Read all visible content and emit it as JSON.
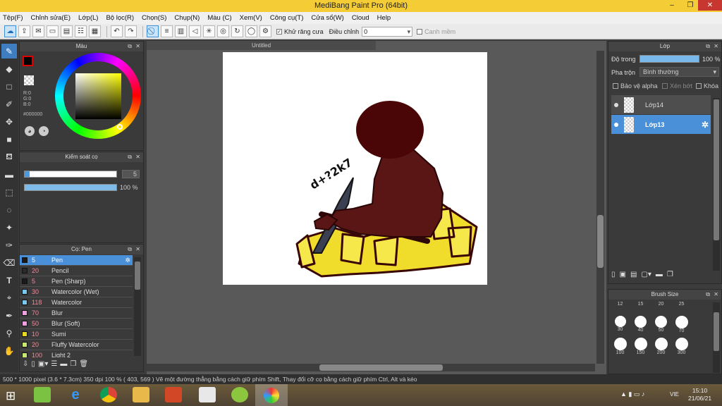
{
  "app": {
    "title": "MediBang Paint Pro (64bit)"
  },
  "menu": [
    "Tệp(F)",
    "Chỉnh sửa(E)",
    "Lớp(L)",
    "Bộ lọc(R)",
    "Chọn(S)",
    "Chụp(N)",
    "Màu (C)",
    "Xem(V)",
    "Công cụ(T)",
    "Cửa sổ(W)",
    "Cloud",
    "Help"
  ],
  "toolbar": {
    "antialias_label": "Khử răng cưa",
    "adjust_label": "Điều chỉnh",
    "adjust_value": "0",
    "smooth_label": "Canh mềm"
  },
  "color_panel": {
    "title": "Màu",
    "r": "R:0",
    "g": "G:0",
    "b": "B:0",
    "hex": "#000000"
  },
  "brush_control": {
    "title": "Kiểm soát cọ",
    "size_value": "5",
    "opacity_value": "100 %",
    "size_fraction": 0.05,
    "opacity_fraction": 1.0
  },
  "brush_list": {
    "title": "Cọ: Pen",
    "items": [
      {
        "size": "5",
        "name": "Pen",
        "color": "#1a1a1a",
        "selected": true
      },
      {
        "size": "20",
        "name": "Pencil",
        "color": "#2a2a2a"
      },
      {
        "size": "5",
        "name": "Pen (Sharp)",
        "color": "#1a1a1a"
      },
      {
        "size": "30",
        "name": "Watercolor (Wet)",
        "color": "#78c8f0"
      },
      {
        "size": "118",
        "name": "Watercolor",
        "color": "#78c8f0"
      },
      {
        "size": "70",
        "name": "Blur",
        "color": "#f0a0e0"
      },
      {
        "size": "50",
        "name": "Blur (Soft)",
        "color": "#f0a0e0"
      },
      {
        "size": "10",
        "name": "Sumi",
        "color": "#e8d820"
      },
      {
        "size": "20",
        "name": "Fluffy Watercolor",
        "color": "#c8e870"
      },
      {
        "size": "100",
        "name": "Light 2",
        "color": "#c8e870"
      }
    ]
  },
  "canvas": {
    "tab_title": "Untitled",
    "drawing_text": "d+?2k7"
  },
  "layers": {
    "title": "Lớp",
    "opacity_label": "Độ trong",
    "opacity_value": "100 %",
    "opacity_fraction": 1.0,
    "blend_label": "Pha trộn",
    "blend_value": "Bình thường",
    "protect_alpha": "Bảo vệ alpha",
    "clipping": "Xén bớt",
    "lock": "Khóa",
    "items": [
      {
        "name": "Lớp14",
        "selected": false
      },
      {
        "name": "Lớp13",
        "selected": true
      }
    ]
  },
  "brush_size": {
    "title": "Brush Size",
    "row1": [
      "12",
      "15",
      "20",
      "25"
    ],
    "row2": [
      "30",
      "40",
      "50",
      "70"
    ],
    "row3": [
      "100",
      "150",
      "200",
      "300"
    ]
  },
  "status": {
    "text": "500 * 1000 pixel   (3.6 * 7.3cm)   350 dpi   100 %   ( 403, 569 )   Vẽ một đường thẳng bằng cách giữ phím Shift, Thay đổi cỡ cọ bằng cách giữ phím Ctrl, Alt và kéo"
  },
  "taskbar": {
    "lang": "VIE",
    "time": "15:10",
    "date": "21/06/21"
  }
}
